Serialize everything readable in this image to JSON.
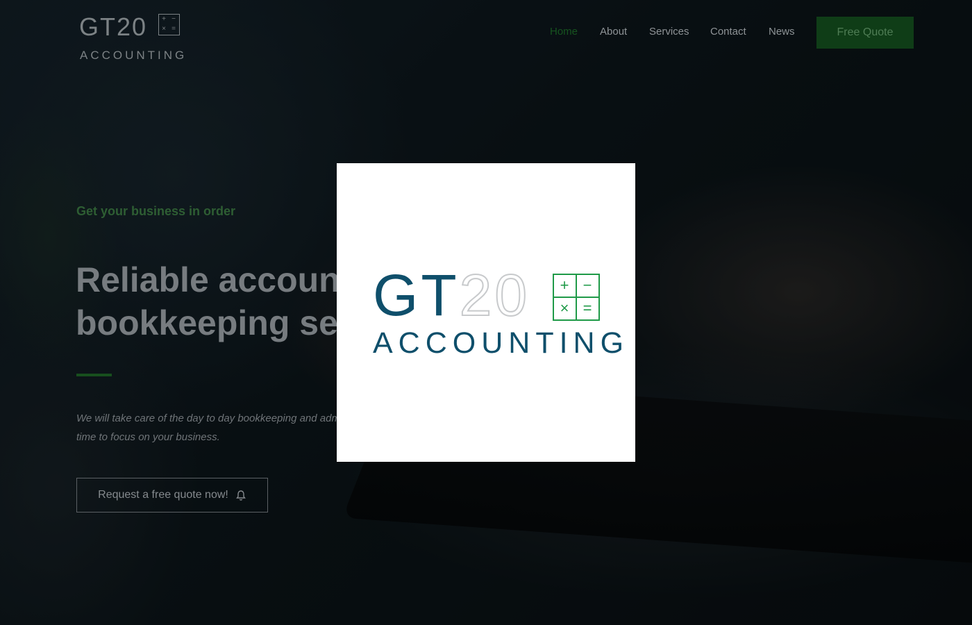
{
  "colors": {
    "accent_green": "#1f9a48",
    "brand_teal": "#0f4f6b",
    "nav_active": "#16541f",
    "cta_bg": "#0f3d17"
  },
  "header": {
    "logo": {
      "main": "GT20",
      "sub": "ACCOUNTING",
      "symbols": [
        "+",
        "−",
        "×",
        "="
      ]
    },
    "nav": [
      "Home",
      "About",
      "Services",
      "Contact",
      "News"
    ],
    "active_nav": "Home",
    "quote_button": "Free Quote"
  },
  "hero": {
    "eyebrow": "Get your business in order",
    "headline_line1": "Reliable account",
    "headline_line2": "bookkeeping ser",
    "subtext_line1": "We will take care of the day to day bookkeeping and adm",
    "subtext_line2": "time to focus on your business.",
    "cta_label": "Request a free quote now!",
    "cta_icon": "bell-icon"
  },
  "modal": {
    "logo_gt": "GT",
    "logo_num": "20",
    "logo_sub": "ACCOUNTING",
    "symbols": [
      "+",
      "−",
      "×",
      "="
    ]
  }
}
